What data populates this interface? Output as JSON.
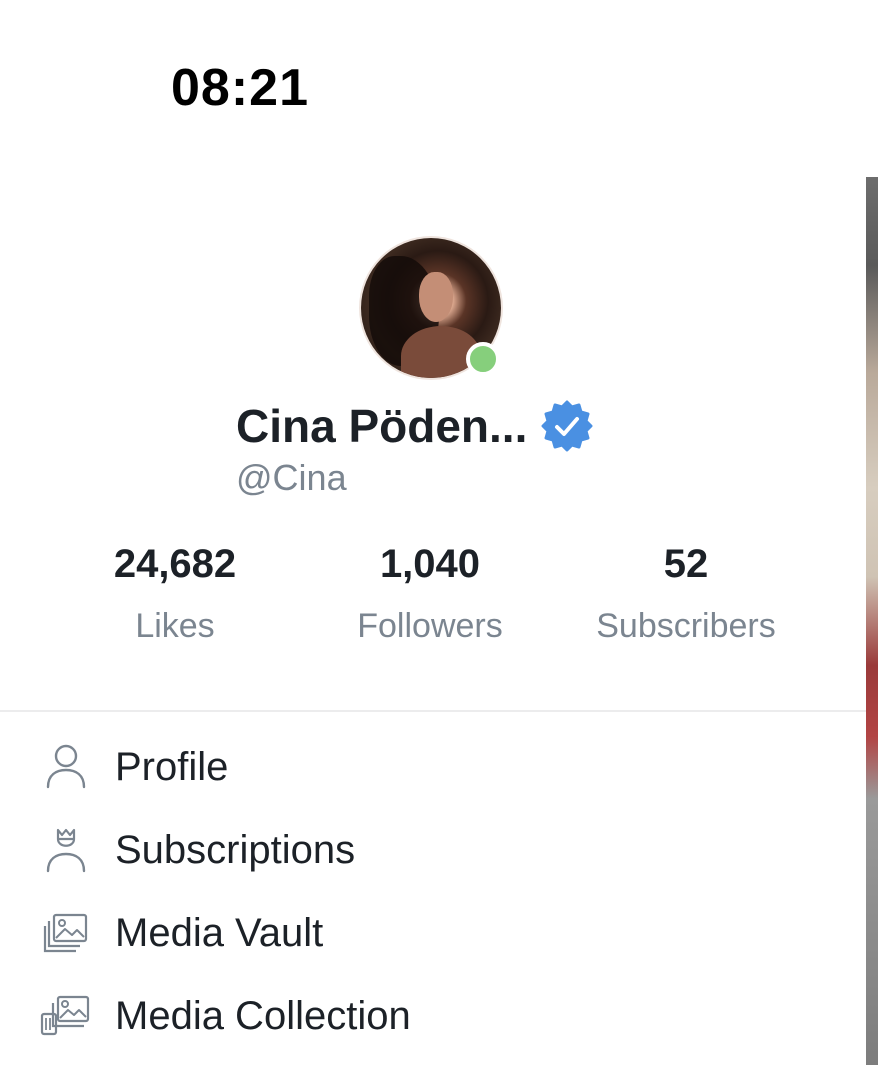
{
  "status_bar": {
    "time": "08:21"
  },
  "profile": {
    "display_name": "Cina Pöden...",
    "handle": "@Cina",
    "verified": true,
    "online": true,
    "accent_color": "#4a90e2",
    "online_color": "#86cf7c"
  },
  "stats": [
    {
      "value": "24,682",
      "label": "Likes"
    },
    {
      "value": "1,040",
      "label": "Followers"
    },
    {
      "value": "52",
      "label": "Subscribers"
    }
  ],
  "menu": [
    {
      "label": "Profile",
      "icon": "user-icon"
    },
    {
      "label": "Subscriptions",
      "icon": "crowned-user-icon"
    },
    {
      "label": "Media Vault",
      "icon": "image-stack-icon"
    },
    {
      "label": "Media Collection",
      "icon": "image-collection-icon"
    }
  ]
}
